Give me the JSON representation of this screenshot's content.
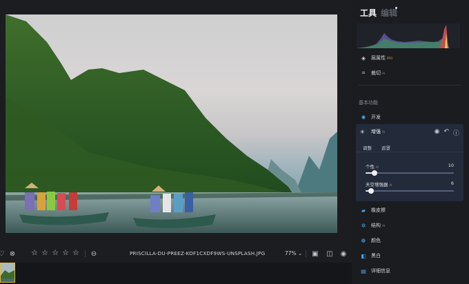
{
  "photo": {
    "filename": "PRISCILLA-DU-PREEZ-KOF1CXDF9WS-UNSPLASH.JPG",
    "zoom": "77%"
  },
  "sidebar": {
    "tab_tools": "工具",
    "tab_edit": "编辑",
    "layer_props": "层属性",
    "layer_props_tag": "PRO",
    "crop": "裁切",
    "crop_tag": "AI",
    "section_basic": "基本功能",
    "develop": "开发",
    "enhance": {
      "title": "增强",
      "tag": "AI",
      "subtabs": [
        "调整",
        "遮罩"
      ],
      "sliders": [
        {
          "label": "个性",
          "tag": "AI",
          "value": "10",
          "fraction": 0.1
        },
        {
          "label": "天空增强器",
          "tag": "AI",
          "value": "6",
          "fraction": 0.06
        }
      ]
    },
    "tools": [
      {
        "label": "橡皮擦",
        "tag": ""
      },
      {
        "label": "结构",
        "tag": "AI"
      },
      {
        "label": "颜色",
        "tag": ""
      },
      {
        "label": "黑白",
        "tag": ""
      },
      {
        "label": "详细信息",
        "tag": ""
      }
    ]
  },
  "rating": {
    "stars": 0,
    "max": 5
  },
  "colors": {
    "accent": "#e0b83d",
    "panel": "#232a3a"
  }
}
